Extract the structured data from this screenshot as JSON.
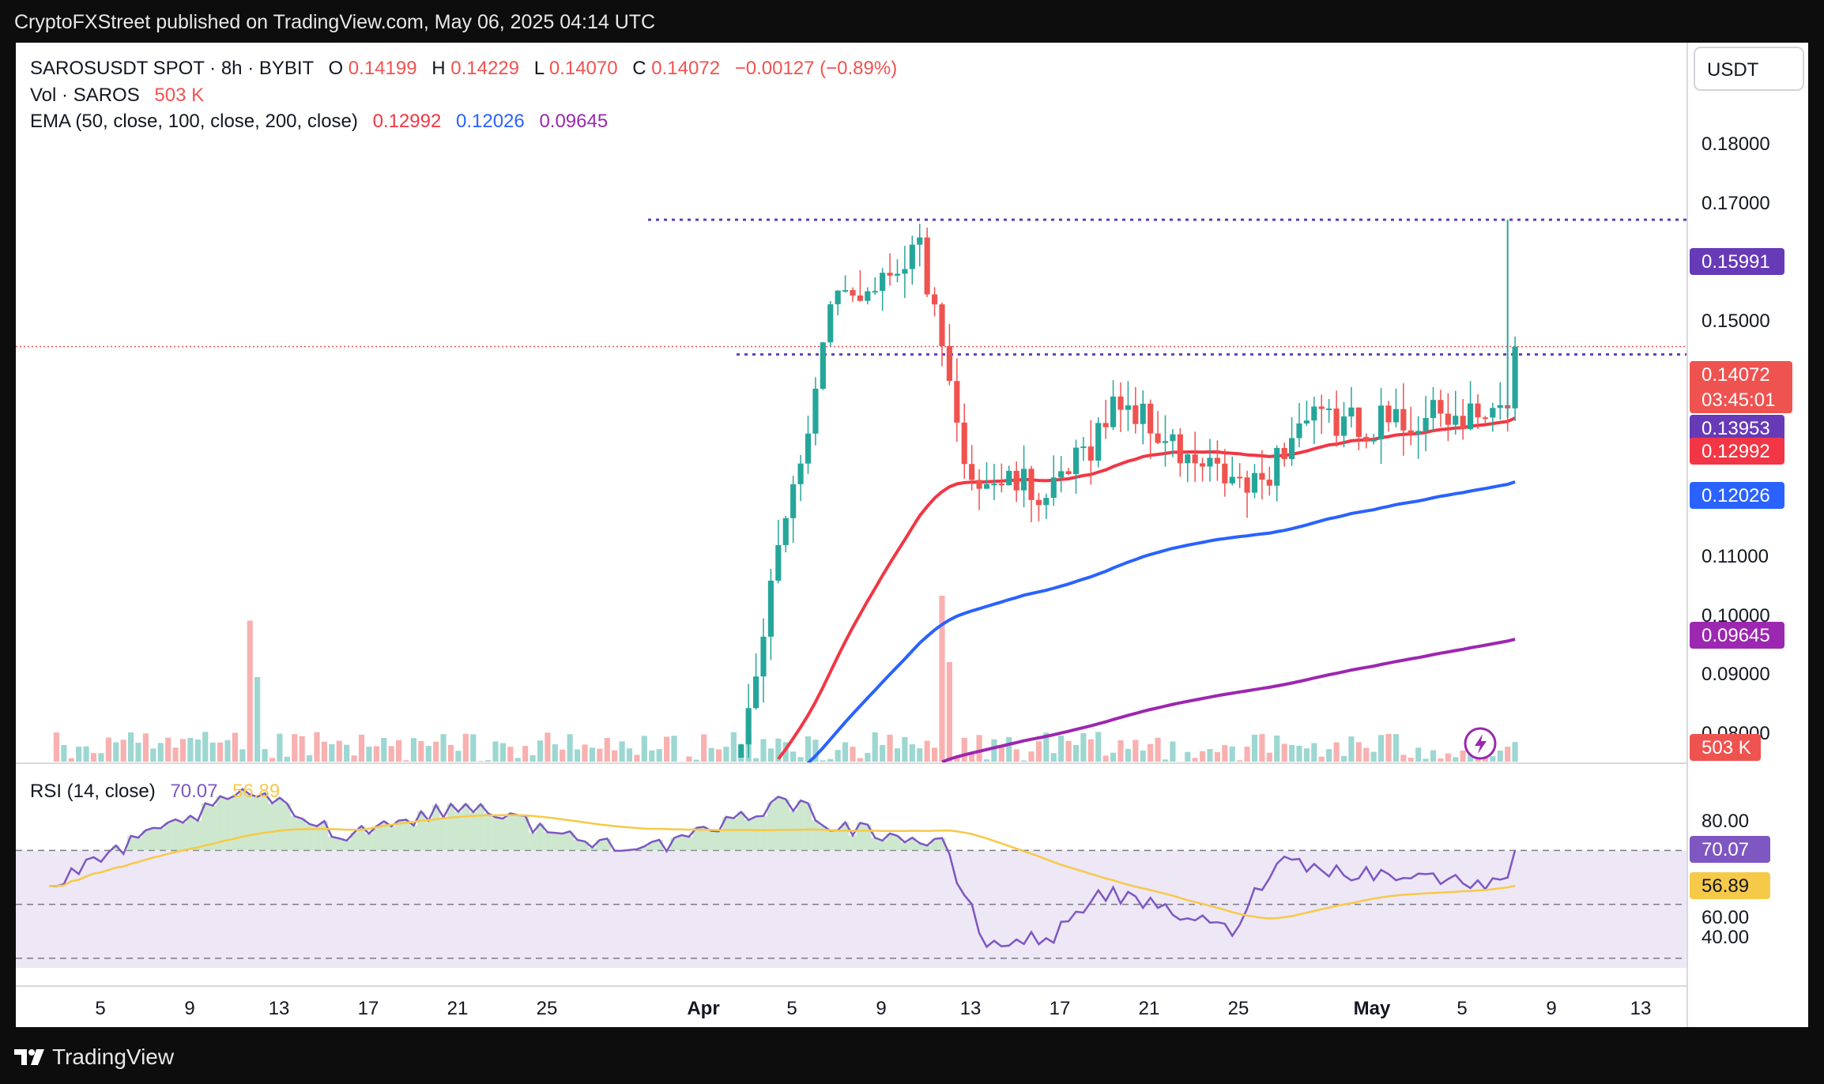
{
  "publisher_line": "CryptoFXStreet published on TradingView.com, May 06, 2025 04:14 UTC",
  "footer_brand": "TradingView",
  "colors": {
    "up": "#26a69a",
    "down": "#ef5350",
    "ema50": "#f23645",
    "ema100": "#2962ff",
    "ema200": "#9c27b0",
    "rsi": "#7e57c2",
    "rsi_ma": "#f7c948",
    "level_line": "#673ab7"
  },
  "legend": {
    "symbol": "SAROSUSDT SPOT · 8h · BYBIT",
    "o_label": "O",
    "o_value": "0.14199",
    "h_label": "H",
    "h_value": "0.14229",
    "l_label": "L",
    "l_value": "0.14070",
    "c_label": "C",
    "c_value": "0.14072",
    "change": "−0.00127 (−0.89%)",
    "vol_label": "Vol · SAROS",
    "vol_value": "503 K",
    "ema_label": "EMA (50, close, 100, close, 200, close)",
    "ema50_value": "0.12992",
    "ema100_value": "0.12026",
    "ema200_value": "0.09645"
  },
  "currency_button": "USDT",
  "price_axis": {
    "ticks": [
      "0.18000",
      "0.17000",
      "0.15000",
      "0.11000",
      "0.10000",
      "0.09000",
      "0.08000"
    ],
    "labels": {
      "resistance": "0.15991",
      "last_price": "0.14072",
      "countdown": "03:45:01",
      "support": "0.13953",
      "ema50": "0.12992",
      "ema100": "0.12026",
      "ema200": "0.09645",
      "volume": "503 K"
    }
  },
  "rsi_panel": {
    "legend_label": "RSI (14, close)",
    "rsi_value": "70.07",
    "ma_value": "56.89",
    "ticks": [
      "80.00",
      "40.00"
    ],
    "hidden_tick": "60.00",
    "labels": {
      "rsi": "70.07",
      "ma": "56.89"
    }
  },
  "time_axis": [
    "5",
    "9",
    "13",
    "17",
    "21",
    "25",
    "Apr",
    "5",
    "9",
    "13",
    "17",
    "21",
    "25",
    "May",
    "5",
    "9",
    "13"
  ],
  "chart_data": [
    {
      "type": "candlestick",
      "title": "SAROSUSDT SPOT · 8h · BYBIT",
      "interval": "8h",
      "y_scale": "linear",
      "ylim": [
        0.0765,
        0.1855
      ],
      "x_days": [
        0,
        75
      ],
      "x_tick_labels": [
        "5",
        "9",
        "13",
        "17",
        "21",
        "25",
        "Apr",
        "5",
        "9",
        "13",
        "17",
        "21",
        "25",
        "May",
        "5",
        "9",
        "13"
      ],
      "last_price": 0.14072,
      "horizontal_levels": [
        0.15991,
        0.13953
      ],
      "series": [
        {
          "name": "Price",
          "segments": [
            {
              "from": "Apr 1",
              "to": "Apr 5",
              "start": 0.0815,
              "end": 0.146
            },
            {
              "from": "Apr 5",
              "to": "Apr 9",
              "start": 0.146,
              "end": 0.156
            },
            {
              "from": "Apr 9",
              "to": "Apr 11",
              "start": 0.156,
              "end": 0.122
            },
            {
              "from": "Apr 11",
              "to": "Apr 15",
              "start": 0.122,
              "end": 0.118
            },
            {
              "from": "Apr 15",
              "to": "Apr 18",
              "start": 0.118,
              "end": 0.133
            },
            {
              "from": "Apr 18",
              "to": "Apr 21",
              "start": 0.133,
              "end": 0.123
            },
            {
              "from": "Apr 21",
              "to": "Apr 24",
              "start": 0.123,
              "end": 0.119
            },
            {
              "from": "Apr 24",
              "to": "Apr 26",
              "start": 0.119,
              "end": 0.129
            },
            {
              "from": "Apr 26",
              "to": "May 5",
              "start": 0.129,
              "end": 0.13
            },
            {
              "from": "May 5",
              "to": "May 6",
              "start": 0.13,
              "end": 0.1407
            }
          ]
        },
        {
          "name": "EMA 50",
          "last": 0.12992
        },
        {
          "name": "EMA 100",
          "last": 0.12026
        },
        {
          "name": "EMA 200",
          "last": 0.09645
        }
      ]
    },
    {
      "type": "bar",
      "title": "Vol · SAROS",
      "last": "503 K",
      "spikes": [
        {
          "date": "Mar 10",
          "relative": 0.85
        },
        {
          "date": "Apr 10",
          "relative": 1.0
        }
      ]
    },
    {
      "type": "line",
      "title": "RSI (14, close)",
      "ylim": [
        20,
        100
      ],
      "band": [
        30,
        70
      ],
      "series": [
        {
          "name": "RSI",
          "last": 70.07,
          "points": [
            {
              "date": "Mar 1",
              "value": 56
            },
            {
              "date": "Mar 4",
              "value": 70
            },
            {
              "date": "Mar 10",
              "value": 92
            },
            {
              "date": "Mar 14",
              "value": 76
            },
            {
              "date": "Mar 20",
              "value": 87
            },
            {
              "date": "Mar 25",
              "value": 73
            },
            {
              "date": "Mar 29",
              "value": 72
            },
            {
              "date": "Apr 3",
              "value": 89
            },
            {
              "date": "Apr 5",
              "value": 80
            },
            {
              "date": "Apr 10",
              "value": 72
            },
            {
              "date": "Apr 12",
              "value": 35
            },
            {
              "date": "Apr 15",
              "value": 38
            },
            {
              "date": "Apr 17",
              "value": 55
            },
            {
              "date": "Apr 20",
              "value": 48
            },
            {
              "date": "Apr 23",
              "value": 40
            },
            {
              "date": "Apr 25",
              "value": 67
            },
            {
              "date": "Apr 28",
              "value": 62
            },
            {
              "date": "May 2",
              "value": 60
            },
            {
              "date": "May 5",
              "value": 57
            },
            {
              "date": "May 6",
              "value": 70
            }
          ]
        },
        {
          "name": "RSI-based MA",
          "last": 56.89
        }
      ]
    }
  ]
}
